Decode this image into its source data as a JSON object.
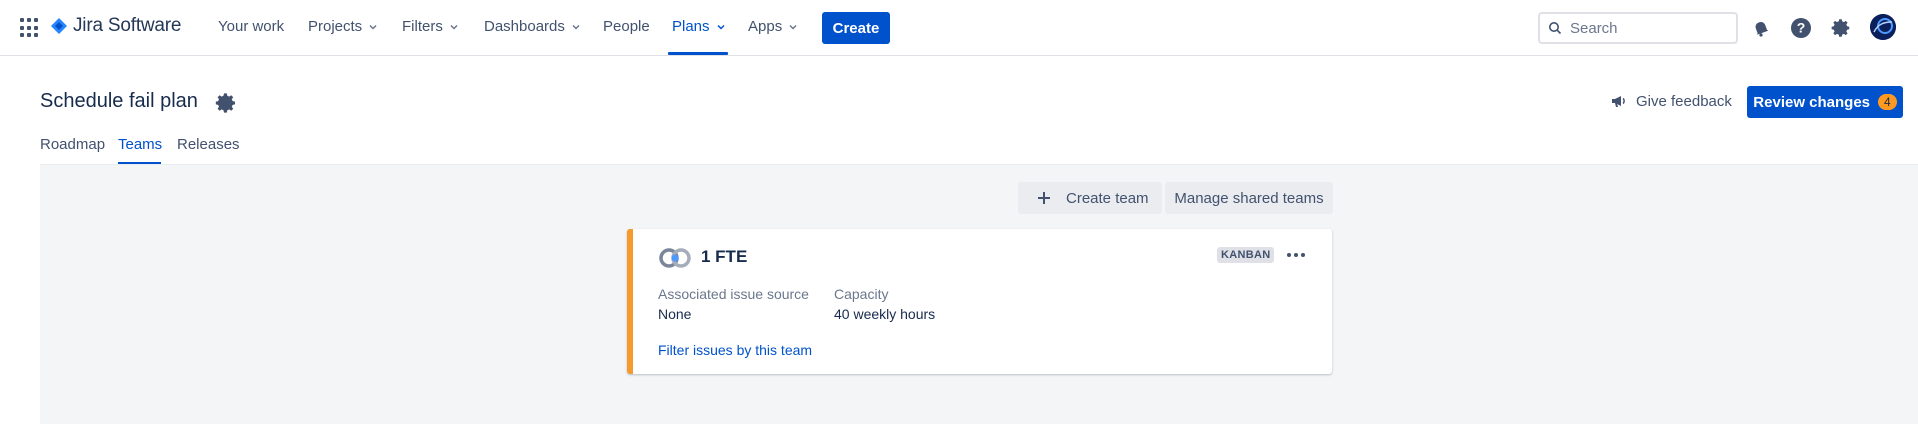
{
  "app": {
    "name": "Jira Software"
  },
  "nav": {
    "items": [
      {
        "label": "Your work",
        "dropdown": false
      },
      {
        "label": "Projects",
        "dropdown": true
      },
      {
        "label": "Filters",
        "dropdown": true
      },
      {
        "label": "Dashboards",
        "dropdown": true
      },
      {
        "label": "People",
        "dropdown": false
      },
      {
        "label": "Plans",
        "dropdown": true,
        "active": true
      },
      {
        "label": "Apps",
        "dropdown": true
      }
    ],
    "create_label": "Create",
    "search_placeholder": "Search",
    "icons": [
      "notifications-icon",
      "help-icon",
      "settings-icon",
      "avatar"
    ]
  },
  "page": {
    "title": "Schedule fail plan",
    "feedback_label": "Give feedback",
    "review_label": "Review changes",
    "review_count": "4"
  },
  "tabs": [
    {
      "label": "Roadmap",
      "active": false
    },
    {
      "label": "Teams",
      "active": true
    },
    {
      "label": "Releases",
      "active": false
    }
  ],
  "actions": {
    "create_team_label": "Create team",
    "manage_shared_label": "Manage shared teams"
  },
  "team": {
    "name": "1 FTE",
    "type_badge": "KANBAN",
    "issue_source_label": "Associated issue source",
    "issue_source_value": "None",
    "capacity_label": "Capacity",
    "capacity_value": "40 weekly hours",
    "filter_link": "Filter issues by this team"
  },
  "colors": {
    "brand": "#0052cc",
    "accent_team": "#f79a2e",
    "review_badge": "#ff991f",
    "content_bg": "#f4f5f7"
  }
}
